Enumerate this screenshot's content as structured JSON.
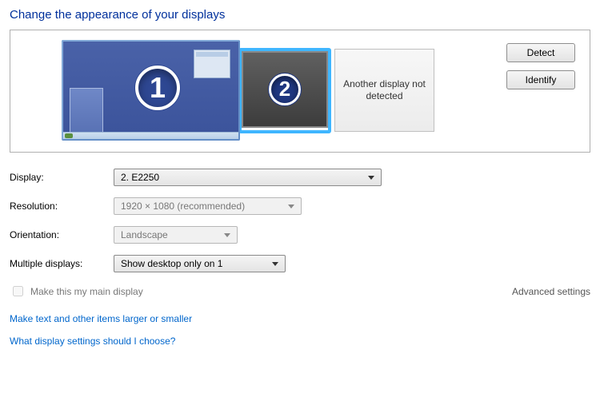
{
  "title": "Change the appearance of your displays",
  "preview": {
    "monitor1_num": "1",
    "monitor2_num": "2",
    "not_detected": "Another display not detected"
  },
  "buttons": {
    "detect": "Detect",
    "identify": "Identify"
  },
  "labels": {
    "display": "Display:",
    "resolution": "Resolution:",
    "orientation": "Orientation:",
    "multiple": "Multiple displays:"
  },
  "values": {
    "display": "2. E2250",
    "resolution": "1920 × 1080 (recommended)",
    "orientation": "Landscape",
    "multiple": "Show desktop only on 1"
  },
  "main_display_checkbox": "Make this my main display",
  "advanced": "Advanced settings",
  "links": {
    "text_size": "Make text and other items larger or smaller",
    "help": "What display settings should I choose?"
  }
}
